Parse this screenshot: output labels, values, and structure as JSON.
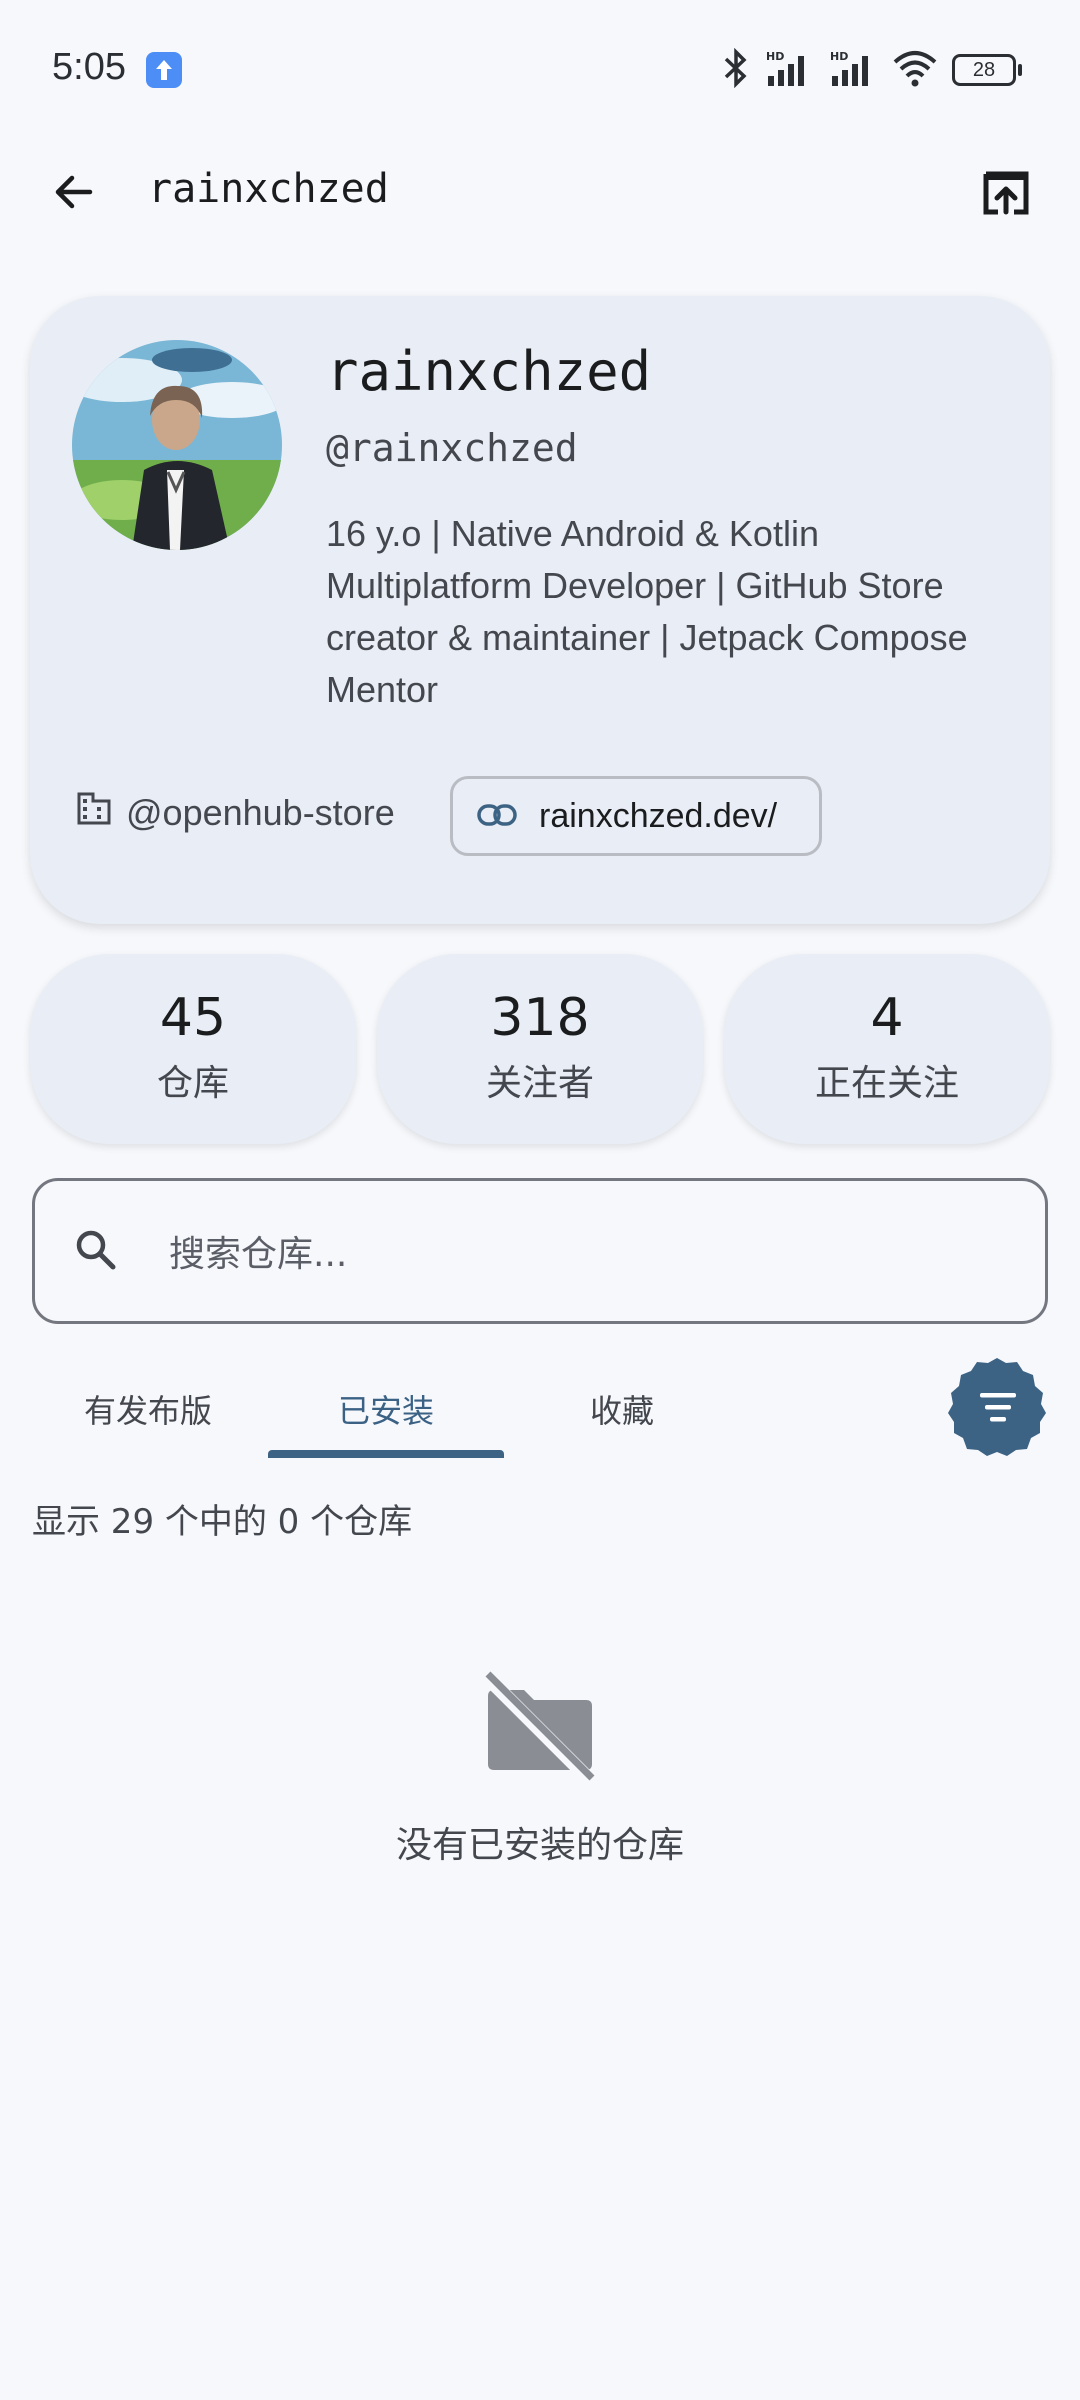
{
  "status_bar": {
    "time": "5:05",
    "icons": [
      "upload-notification-icon",
      "bluetooth-icon",
      "hd-signal-icon",
      "hd-signal-icon",
      "wifi-icon"
    ],
    "battery": "28"
  },
  "app_bar": {
    "title": "rainxchzed",
    "back_icon": "arrow-left-icon",
    "action_icon": "open-in-browser-icon"
  },
  "profile": {
    "name": "rainxchzed",
    "handle": "@rainxchzed",
    "bio": "16 y.o | Native Android & Kotlin Multiplatform Developer | GitHub Store creator & maintainer | Jetpack Compose Mentor",
    "company": "@openhub-store",
    "company_icon": "building-icon",
    "website": "rainxchzed.dev/",
    "website_icon": "link-icon"
  },
  "stats": [
    {
      "value": "45",
      "label": "仓库"
    },
    {
      "value": "318",
      "label": "关注者"
    },
    {
      "value": "4",
      "label": "正在关注"
    }
  ],
  "search": {
    "placeholder": "搜索仓库...",
    "icon": "search-icon"
  },
  "tabs": [
    {
      "label": "有发布版",
      "active": false
    },
    {
      "label": "已安装",
      "active": true
    },
    {
      "label": "收藏",
      "active": false
    }
  ],
  "sort_button_icon": "sort-icon",
  "result_count": "显示 29 个中的 0 个仓库",
  "empty_state": {
    "icon": "folder-off-icon",
    "message": "没有已安装的仓库"
  },
  "colors": {
    "background": "#f6f8fc",
    "card": "#e9edf5",
    "accent": "#3d6384",
    "text_primary": "#1a1c1e",
    "text_secondary": "#44474e"
  }
}
